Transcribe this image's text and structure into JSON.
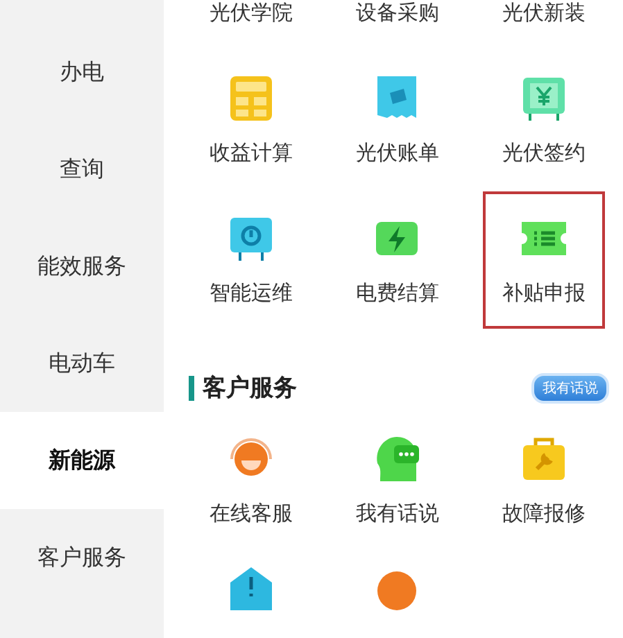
{
  "sidebar": {
    "items": [
      {
        "label": "办电",
        "selected": false
      },
      {
        "label": "查询",
        "selected": false
      },
      {
        "label": "能效服务",
        "selected": false
      },
      {
        "label": "电动车",
        "selected": false
      },
      {
        "label": "新能源",
        "selected": true
      },
      {
        "label": "客户服务",
        "selected": false
      }
    ]
  },
  "solar_section": {
    "cut_row": [
      "光伏学院",
      "设备采购",
      "光伏新装"
    ],
    "tiles": [
      {
        "label": "收益计算",
        "highlighted": false
      },
      {
        "label": "光伏账单",
        "highlighted": false
      },
      {
        "label": "光伏签约",
        "highlighted": false
      },
      {
        "label": "智能运维",
        "highlighted": false
      },
      {
        "label": "电费结算",
        "highlighted": false
      },
      {
        "label": "补贴申报",
        "highlighted": true
      }
    ]
  },
  "service_section": {
    "title": "客户服务",
    "badge": "我有话说",
    "tiles": [
      {
        "label": "在线客服"
      },
      {
        "label": "我有话说"
      },
      {
        "label": "故障报修"
      }
    ],
    "cut_row": [
      {
        "kind": "envelope"
      },
      {
        "kind": "circle"
      }
    ]
  }
}
